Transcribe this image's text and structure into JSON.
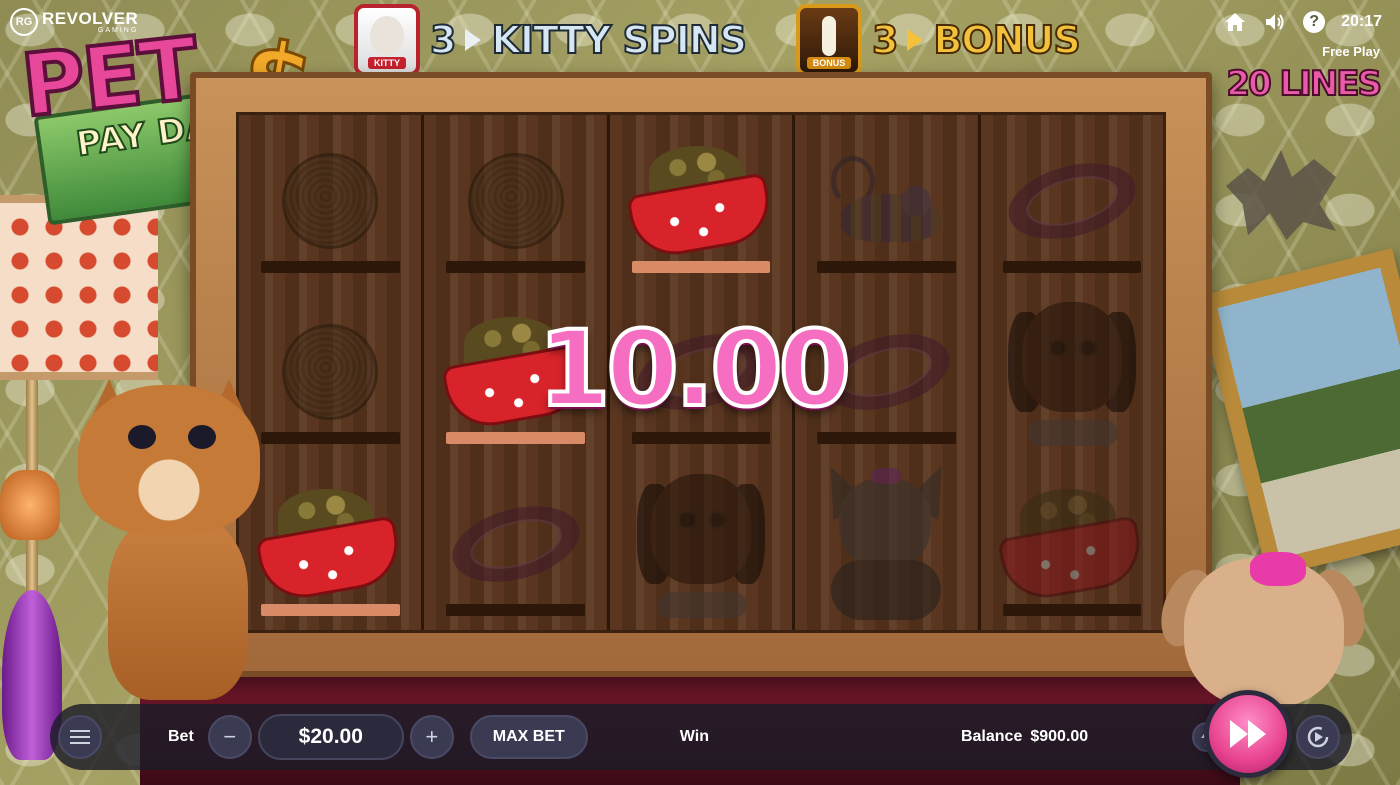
{
  "brand": {
    "name": "REVOLVER",
    "sub": "GAMING",
    "badge": "RG"
  },
  "logo": {
    "line1": "PET",
    "line2": "PAY DAY",
    "symbol": "$"
  },
  "features": [
    {
      "icon": "kitty-icon",
      "tag": "KITTY",
      "count": "3",
      "label": "KITTY SPINS"
    },
    {
      "icon": "bonus-icon",
      "tag": "BONUS",
      "count": "3",
      "label": "BONUS"
    }
  ],
  "top_right": {
    "time": "20:17",
    "mode": "Free Play",
    "lines": "20 LINES"
  },
  "reels": [
    [
      "yarn",
      "yarn",
      "bowl"
    ],
    [
      "yarn",
      "bowl",
      "collar"
    ],
    [
      "bowl",
      "collar",
      "puppy"
    ],
    [
      "mouse",
      "collar",
      "chihuahua"
    ],
    [
      "collar",
      "puppy",
      "bowl"
    ]
  ],
  "win_amount": "10.00",
  "controls": {
    "bet_label": "Bet",
    "bet_value": "$20.00",
    "minus": "−",
    "plus": "+",
    "max_bet": "MAX BET",
    "win_label": "Win",
    "balance_label": "Balance",
    "balance_value": "$900.00"
  },
  "colors": {
    "accent": "#e8438f",
    "bar": "#1c1c28",
    "win_text": "#f56ec2"
  }
}
